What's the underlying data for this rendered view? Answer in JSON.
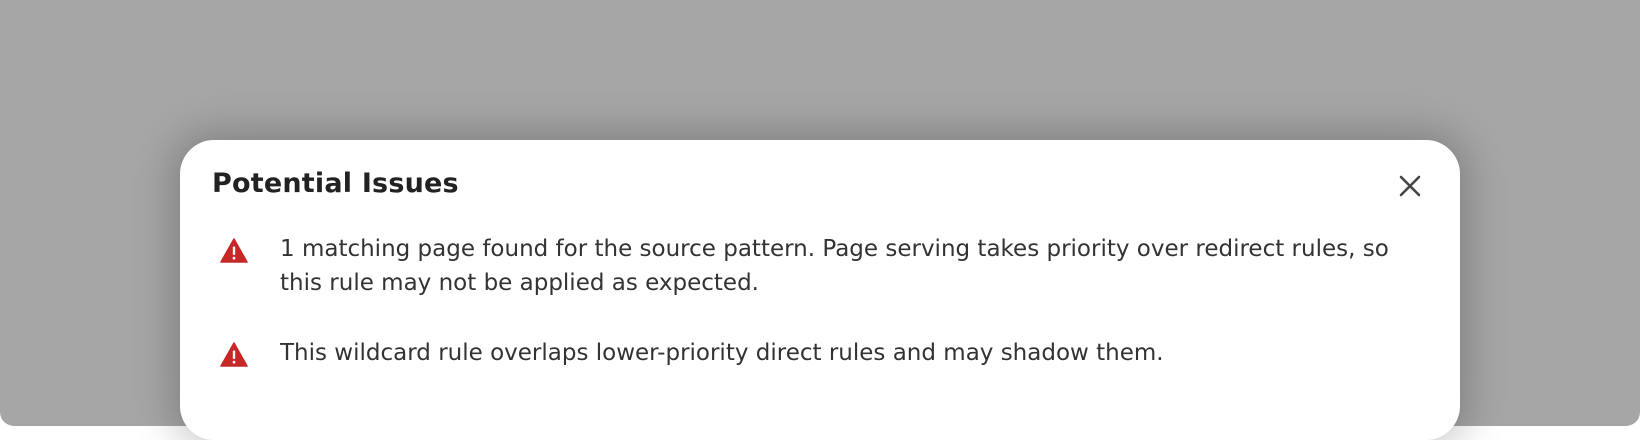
{
  "dialog": {
    "title": "Potential Issues",
    "close_icon": "close-icon",
    "warning_color": "#c62828",
    "issues": [
      {
        "icon": "warning-triangle-icon",
        "text": "1 matching page found for the source pattern. Page serving takes priority over redirect rules, so this rule may not be applied as expected."
      },
      {
        "icon": "warning-triangle-icon",
        "text": "This wildcard rule overlaps lower-priority direct rules and may shadow them."
      }
    ]
  }
}
